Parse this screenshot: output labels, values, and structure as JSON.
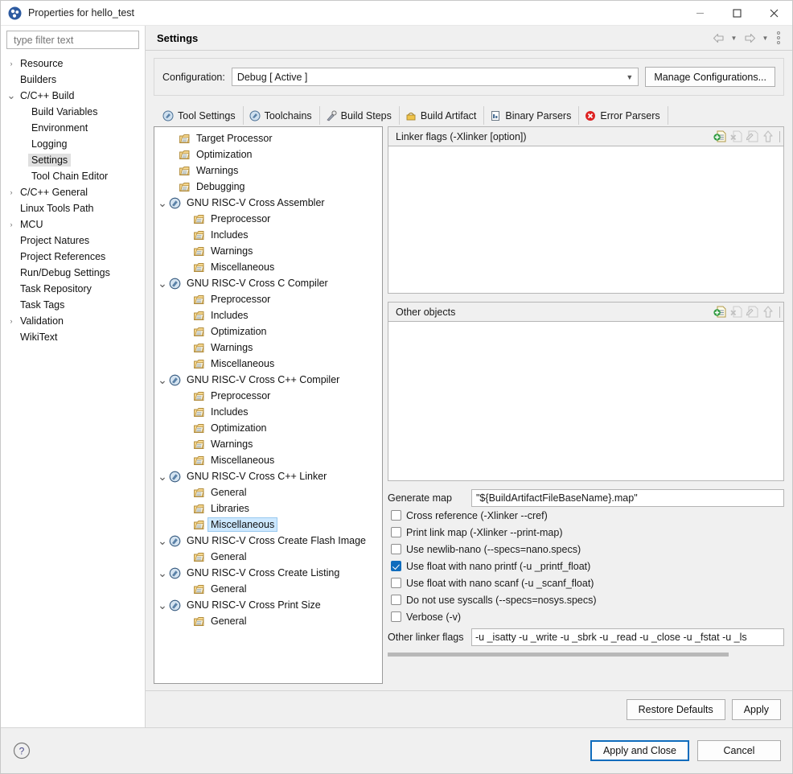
{
  "window": {
    "title": "Properties for hello_test",
    "icon": "eclipse-properties-icon",
    "minimize": "─",
    "maximize": "□",
    "close": "✕"
  },
  "filter": {
    "placeholder": "type filter text",
    "value": ""
  },
  "nav_tree": [
    {
      "label": "Resource",
      "arrow": "collapsed",
      "indent": 0,
      "selected": false
    },
    {
      "label": "Builders",
      "arrow": "none",
      "indent": 0,
      "selected": false
    },
    {
      "label": "C/C++ Build",
      "arrow": "expanded",
      "indent": 0,
      "selected": false
    },
    {
      "label": "Build Variables",
      "arrow": "none",
      "indent": 1,
      "selected": false
    },
    {
      "label": "Environment",
      "arrow": "none",
      "indent": 1,
      "selected": false
    },
    {
      "label": "Logging",
      "arrow": "none",
      "indent": 1,
      "selected": false
    },
    {
      "label": "Settings",
      "arrow": "none",
      "indent": 1,
      "selected": true
    },
    {
      "label": "Tool Chain Editor",
      "arrow": "none",
      "indent": 1,
      "selected": false
    },
    {
      "label": "C/C++ General",
      "arrow": "collapsed",
      "indent": 0,
      "selected": false
    },
    {
      "label": "Linux Tools Path",
      "arrow": "none",
      "indent": 0,
      "selected": false
    },
    {
      "label": "MCU",
      "arrow": "collapsed",
      "indent": 0,
      "selected": false
    },
    {
      "label": "Project Natures",
      "arrow": "none",
      "indent": 0,
      "selected": false
    },
    {
      "label": "Project References",
      "arrow": "none",
      "indent": 0,
      "selected": false
    },
    {
      "label": "Run/Debug Settings",
      "arrow": "none",
      "indent": 0,
      "selected": false
    },
    {
      "label": "Task Repository",
      "arrow": "none",
      "indent": 0,
      "selected": false
    },
    {
      "label": "Task Tags",
      "arrow": "none",
      "indent": 0,
      "selected": false
    },
    {
      "label": "Validation",
      "arrow": "collapsed",
      "indent": 0,
      "selected": false
    },
    {
      "label": "WikiText",
      "arrow": "none",
      "indent": 0,
      "selected": false
    }
  ],
  "page": {
    "title": "Settings",
    "nav_back": "back-arrow-icon",
    "nav_forward": "forward-arrow-icon",
    "nav_menu": "view-menu-icon"
  },
  "configuration": {
    "label": "Configuration:",
    "value": "Debug  [ Active ]",
    "manage_button": "Manage Configurations..."
  },
  "tabs": [
    {
      "label": "Tool Settings",
      "icon": "tool-settings-icon",
      "active": true
    },
    {
      "label": "Toolchains",
      "icon": "toolchains-icon",
      "active": false
    },
    {
      "label": "Build Steps",
      "icon": "build-steps-icon",
      "active": false
    },
    {
      "label": "Build Artifact",
      "icon": "build-artifact-icon",
      "active": false
    },
    {
      "label": "Binary Parsers",
      "icon": "binary-parsers-icon",
      "active": false
    },
    {
      "label": "Error Parsers",
      "icon": "error-parsers-icon",
      "active": false
    }
  ],
  "tool_tree": [
    {
      "label": "Target Processor",
      "level": 1,
      "arrow": "none",
      "icon": "page-icon",
      "selected": false
    },
    {
      "label": "Optimization",
      "level": 1,
      "arrow": "none",
      "icon": "page-icon",
      "selected": false
    },
    {
      "label": "Warnings",
      "level": 1,
      "arrow": "none",
      "icon": "page-icon",
      "selected": false
    },
    {
      "label": "Debugging",
      "level": 1,
      "arrow": "none",
      "icon": "page-icon",
      "selected": false
    },
    {
      "label": "GNU RISC-V Cross Assembler",
      "level": 0,
      "arrow": "expanded",
      "icon": "tool-icon",
      "selected": false
    },
    {
      "label": "Preprocessor",
      "level": 2,
      "arrow": "none",
      "icon": "page-icon",
      "selected": false
    },
    {
      "label": "Includes",
      "level": 2,
      "arrow": "none",
      "icon": "page-icon",
      "selected": false
    },
    {
      "label": "Warnings",
      "level": 2,
      "arrow": "none",
      "icon": "page-icon",
      "selected": false
    },
    {
      "label": "Miscellaneous",
      "level": 2,
      "arrow": "none",
      "icon": "page-icon",
      "selected": false
    },
    {
      "label": "GNU RISC-V Cross C Compiler",
      "level": 0,
      "arrow": "expanded",
      "icon": "tool-icon",
      "selected": false
    },
    {
      "label": "Preprocessor",
      "level": 2,
      "arrow": "none",
      "icon": "page-icon",
      "selected": false
    },
    {
      "label": "Includes",
      "level": 2,
      "arrow": "none",
      "icon": "page-icon",
      "selected": false
    },
    {
      "label": "Optimization",
      "level": 2,
      "arrow": "none",
      "icon": "page-icon",
      "selected": false
    },
    {
      "label": "Warnings",
      "level": 2,
      "arrow": "none",
      "icon": "page-icon",
      "selected": false
    },
    {
      "label": "Miscellaneous",
      "level": 2,
      "arrow": "none",
      "icon": "page-icon",
      "selected": false
    },
    {
      "label": "GNU RISC-V Cross C++ Compiler",
      "level": 0,
      "arrow": "expanded",
      "icon": "tool-icon",
      "selected": false
    },
    {
      "label": "Preprocessor",
      "level": 2,
      "arrow": "none",
      "icon": "page-icon",
      "selected": false
    },
    {
      "label": "Includes",
      "level": 2,
      "arrow": "none",
      "icon": "page-icon",
      "selected": false
    },
    {
      "label": "Optimization",
      "level": 2,
      "arrow": "none",
      "icon": "page-icon",
      "selected": false
    },
    {
      "label": "Warnings",
      "level": 2,
      "arrow": "none",
      "icon": "page-icon",
      "selected": false
    },
    {
      "label": "Miscellaneous",
      "level": 2,
      "arrow": "none",
      "icon": "page-icon",
      "selected": false
    },
    {
      "label": "GNU RISC-V Cross C++ Linker",
      "level": 0,
      "arrow": "expanded",
      "icon": "tool-icon",
      "selected": false
    },
    {
      "label": "General",
      "level": 2,
      "arrow": "none",
      "icon": "page-icon",
      "selected": false
    },
    {
      "label": "Libraries",
      "level": 2,
      "arrow": "none",
      "icon": "page-icon",
      "selected": false
    },
    {
      "label": "Miscellaneous",
      "level": 2,
      "arrow": "none",
      "icon": "page-icon",
      "selected": true
    },
    {
      "label": "GNU RISC-V Cross Create Flash Image",
      "level": 0,
      "arrow": "expanded",
      "icon": "tool-icon",
      "selected": false
    },
    {
      "label": "General",
      "level": 2,
      "arrow": "none",
      "icon": "page-icon",
      "selected": false
    },
    {
      "label": "GNU RISC-V Cross Create Listing",
      "level": 0,
      "arrow": "expanded",
      "icon": "tool-icon",
      "selected": false
    },
    {
      "label": "General",
      "level": 2,
      "arrow": "none",
      "icon": "page-icon",
      "selected": false
    },
    {
      "label": "GNU RISC-V Cross Print Size",
      "level": 0,
      "arrow": "expanded",
      "icon": "tool-icon",
      "selected": false
    },
    {
      "label": "General",
      "level": 2,
      "arrow": "none",
      "icon": "page-icon",
      "selected": false
    }
  ],
  "linker_flags_group": {
    "title": "Linker flags (-Xlinker [option])",
    "items": [],
    "tools": [
      {
        "name": "add-icon",
        "enabled": true
      },
      {
        "name": "delete-icon",
        "enabled": false
      },
      {
        "name": "edit-icon",
        "enabled": false
      },
      {
        "name": "move-up-icon",
        "enabled": false
      }
    ]
  },
  "other_objects_group": {
    "title": "Other objects",
    "items": [],
    "tools": [
      {
        "name": "add-icon",
        "enabled": true
      },
      {
        "name": "delete-icon",
        "enabled": false
      },
      {
        "name": "edit-icon",
        "enabled": false
      },
      {
        "name": "move-up-icon",
        "enabled": false
      }
    ]
  },
  "generate_map": {
    "label": "Generate map",
    "value": "\"${BuildArtifactFileBaseName}.map\""
  },
  "checkboxes": [
    {
      "label": "Cross reference (-Xlinker --cref)",
      "checked": false
    },
    {
      "label": "Print link map (-Xlinker --print-map)",
      "checked": false
    },
    {
      "label": "Use newlib-nano (--specs=nano.specs)",
      "checked": false
    },
    {
      "label": "Use float with nano printf (-u _printf_float)",
      "checked": true
    },
    {
      "label": "Use float with nano scanf (-u _scanf_float)",
      "checked": false
    },
    {
      "label": "Do not use syscalls (--specs=nosys.specs)",
      "checked": false
    },
    {
      "label": "Verbose (-v)",
      "checked": false
    }
  ],
  "other_linker_flags": {
    "label": "Other linker flags",
    "value": "-u _isatty -u _write -u _sbrk -u _read -u _close -u _fstat -u _ls"
  },
  "apply_row": {
    "restore_defaults": "Restore Defaults",
    "apply": "Apply"
  },
  "footer": {
    "help_icon": "help-icon",
    "apply_and_close": "Apply and Close",
    "cancel": "Cancel"
  },
  "colors": {
    "accent": "#0f6cbd",
    "selection": "#cde8ff",
    "nav_selection": "#e0e0e0",
    "panel": "#f0f0f0",
    "border": "#b6b6b6"
  }
}
